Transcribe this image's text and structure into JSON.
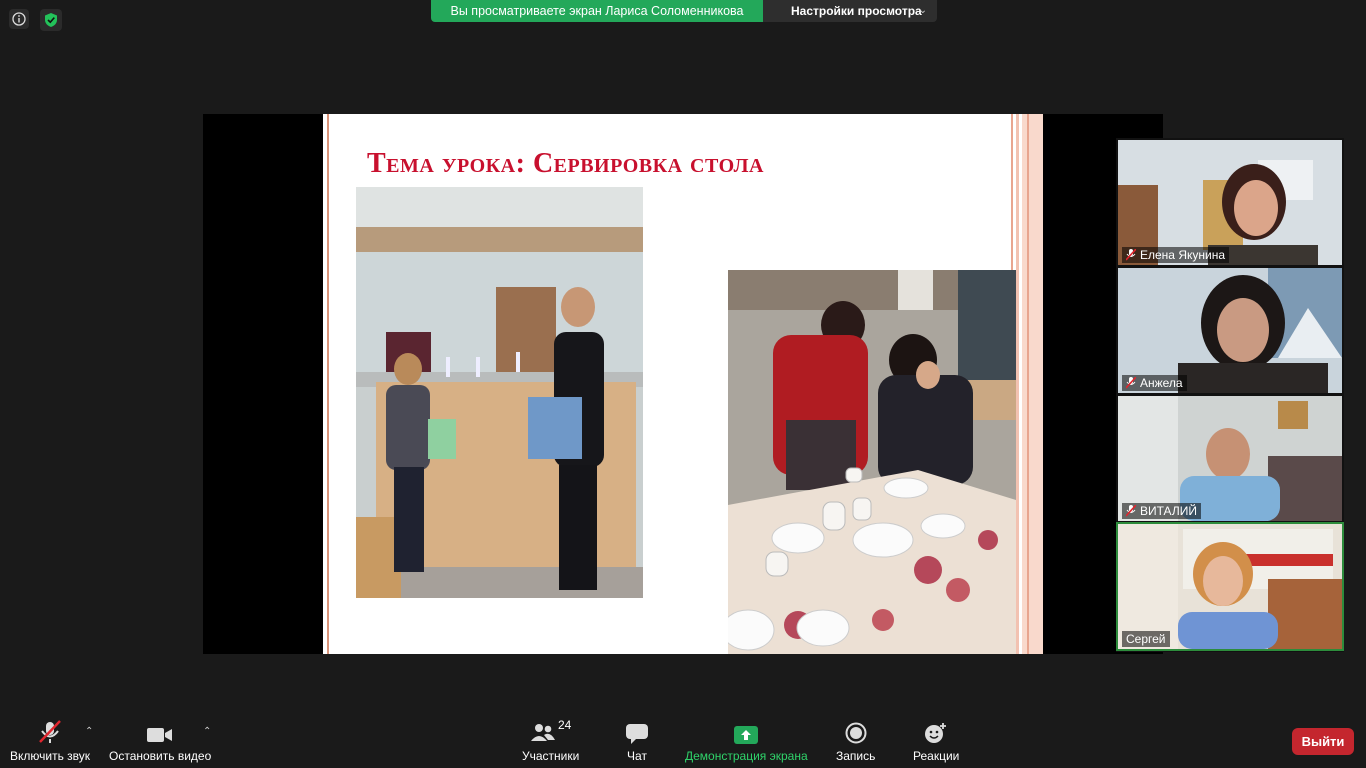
{
  "banner": {
    "viewing_text": "Вы просматриваете экран Лариса Соломенникова",
    "settings_label": "Настройки просмотра"
  },
  "slide": {
    "title": "Тема урока: Сервировка стола"
  },
  "participants": [
    {
      "name": "Елена Якунина",
      "muted": true
    },
    {
      "name": "Анжела",
      "muted": true
    },
    {
      "name": "ВИТАЛИЙ",
      "muted": true
    },
    {
      "name": "Сергей",
      "muted": false
    }
  ],
  "toolbar": {
    "unmute_label": "Включить звук",
    "stop_video_label": "Остановить видео",
    "participants_label": "Участники",
    "participants_count": "24",
    "chat_label": "Чат",
    "share_label": "Демонстрация экрана",
    "record_label": "Запись",
    "reactions_label": "Реакции",
    "leave_label": "Выйти"
  },
  "colors": {
    "banner_green": "#23a85a",
    "title_red": "#c8102e",
    "share_green": "#23a85a",
    "leave_red": "#c4262e",
    "active_speaker": "#2d8c3c"
  },
  "icons": [
    "info-icon",
    "shield-check-icon",
    "mic-muted-icon",
    "video-camera-icon",
    "participants-icon",
    "chat-icon",
    "share-screen-icon",
    "record-icon",
    "reactions-icon",
    "chevron-up-icon",
    "chevron-down-icon"
  ]
}
